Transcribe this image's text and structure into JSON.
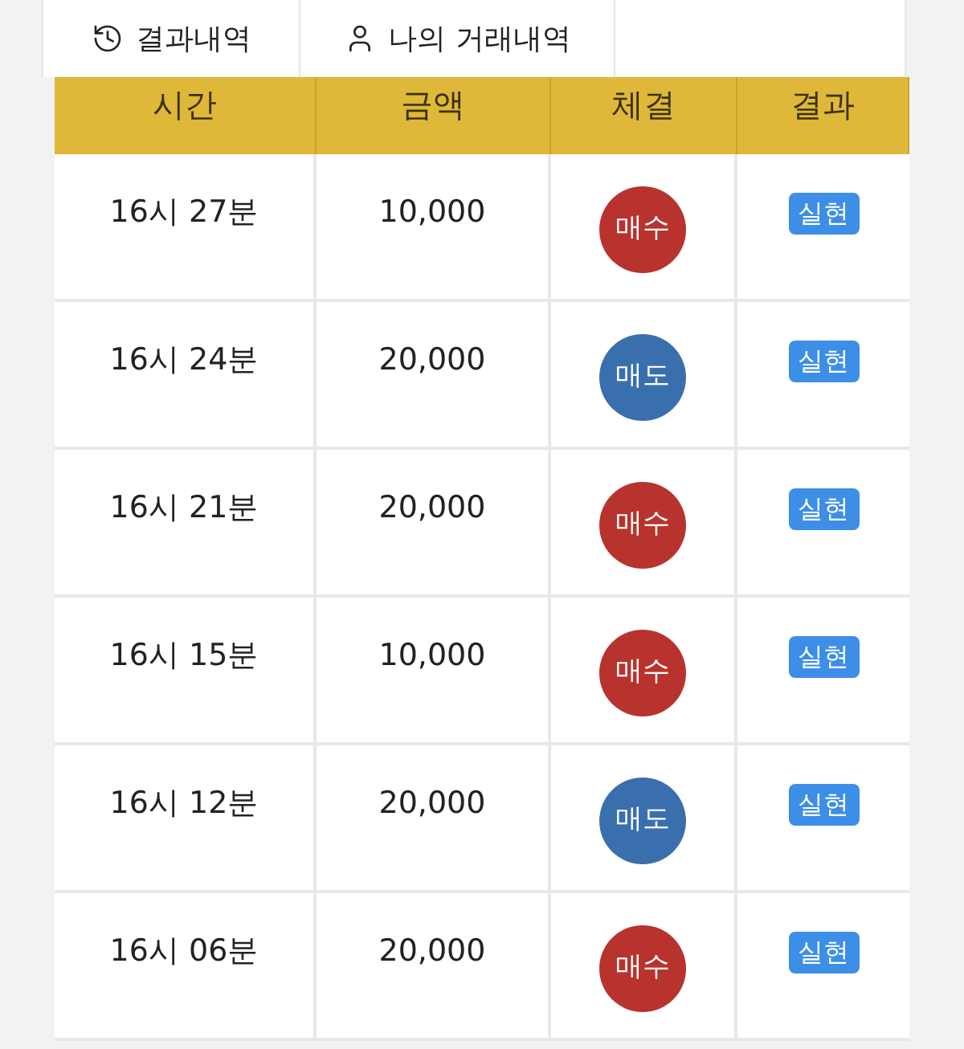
{
  "tabs": [
    {
      "label": "결과내역",
      "kind": "history"
    },
    {
      "label": "나의 거래내역",
      "kind": "account"
    }
  ],
  "table": {
    "columns": [
      "시간",
      "금액",
      "체결",
      "결과"
    ],
    "rows": [
      {
        "time": "16시 27분",
        "amount": "10,000",
        "trade": {
          "kind": "buy",
          "label": "매수"
        },
        "result": "실현"
      },
      {
        "time": "16시 24분",
        "amount": "20,000",
        "trade": {
          "kind": "sell",
          "label": "매도"
        },
        "result": "실현"
      },
      {
        "time": "16시 21분",
        "amount": "20,000",
        "trade": {
          "kind": "buy",
          "label": "매수"
        },
        "result": "실현"
      },
      {
        "time": "16시 15분",
        "amount": "10,000",
        "trade": {
          "kind": "buy",
          "label": "매수"
        },
        "result": "실현"
      },
      {
        "time": "16시 12분",
        "amount": "20,000",
        "trade": {
          "kind": "sell",
          "label": "매도"
        },
        "result": "실현"
      },
      {
        "time": "16시 06분",
        "amount": "20,000",
        "trade": {
          "kind": "buy",
          "label": "매수"
        },
        "result": "실현"
      }
    ]
  }
}
